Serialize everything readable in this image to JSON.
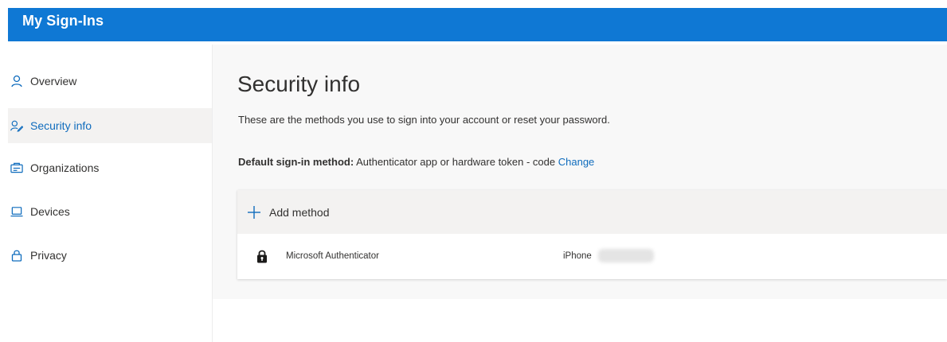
{
  "header": {
    "title": "My Sign-Ins"
  },
  "sidebar": {
    "items": [
      {
        "label": "Overview",
        "icon": "person-icon",
        "active": false
      },
      {
        "label": "Security info",
        "icon": "security-info-icon",
        "active": true
      },
      {
        "label": "Organizations",
        "icon": "organization-icon",
        "active": false
      },
      {
        "label": "Devices",
        "icon": "laptop-icon",
        "active": false
      },
      {
        "label": "Privacy",
        "icon": "lock-icon",
        "active": false
      }
    ]
  },
  "main": {
    "title": "Security info",
    "subtitle": "These are the methods you use to sign into your account or reset your password.",
    "default_method": {
      "label": "Default sign-in method:",
      "value": "Authenticator app or hardware token - code",
      "change_link": "Change"
    },
    "add_method_label": "Add method",
    "methods": [
      {
        "name": "Microsoft Authenticator",
        "device": "iPhone",
        "icon": "authenticator-lock-icon"
      }
    ]
  },
  "colors": {
    "brand_header": "#0f78d4",
    "accent_icon": "#0f6cbd",
    "link": "#0f6cbd",
    "active_nav_bg": "#f3f2f1",
    "main_bg": "#f8f8f8"
  }
}
